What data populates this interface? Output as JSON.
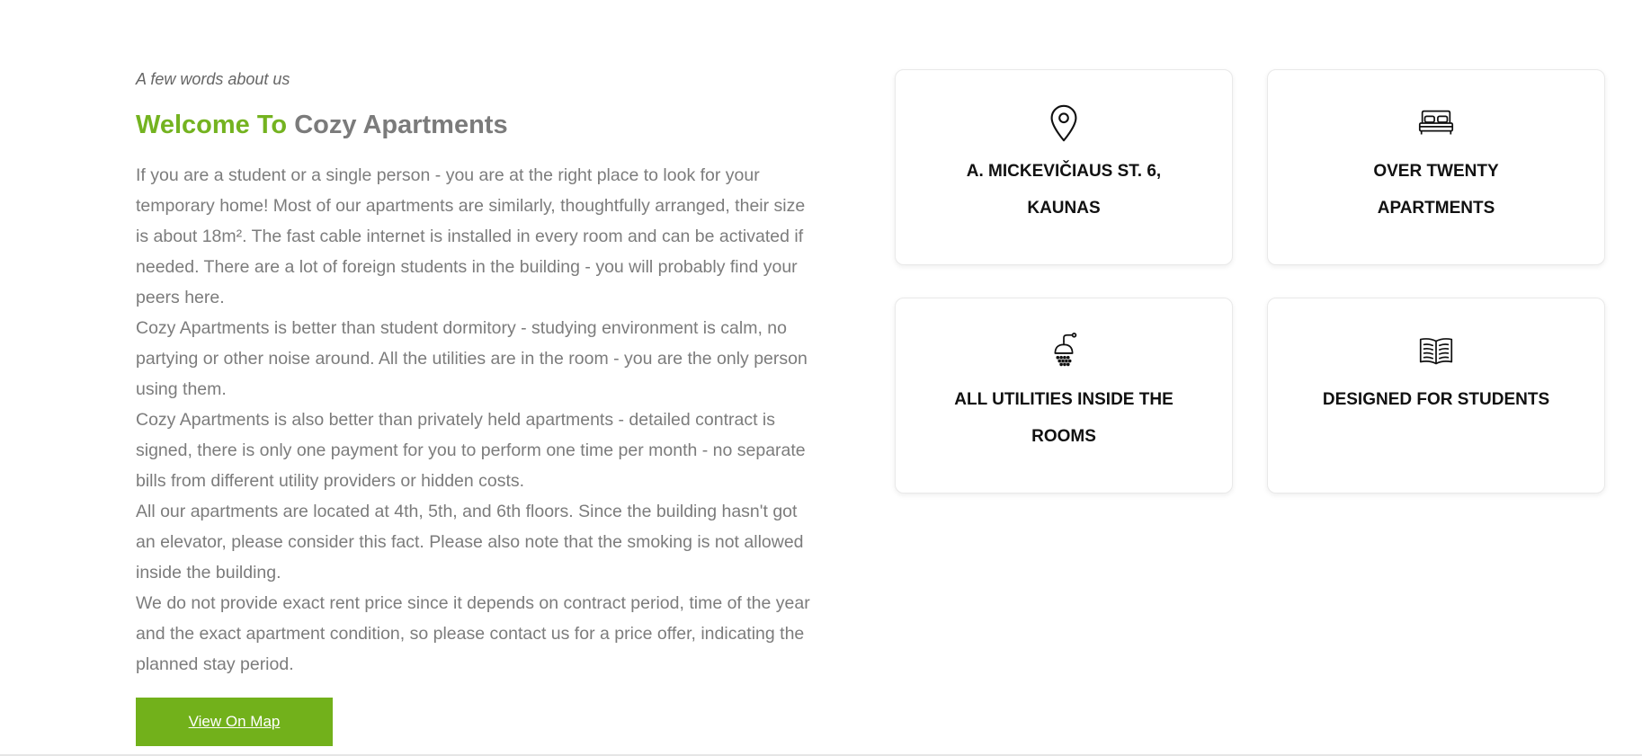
{
  "about": {
    "kicker": "A few words about us",
    "heading_highlight": "Welcome To",
    "heading_rest": "Cozy Apartments",
    "paragraphs": [
      "If you are a student or a single person - you are at the right place to look for your temporary home! Most of our apartments are similarly, thoughtfully arranged, their size is about 18m². The fast cable internet is installed in every room and can be activated if needed. There are a lot of foreign students in the building - you will probably find your peers here.",
      "Cozy Apartments is better than student dormitory - studying environment is calm, no partying or other noise around. All the utilities are in the room - you are the only person using them.",
      "Cozy Apartments is also better than privately held apartments - detailed contract is signed, there is only one payment for you to perform one time per month - no separate bills from different utility providers or hidden costs.",
      "All our apartments are located at 4th, 5th, and 6th floors. Since the building hasn't got an elevator, please consider this fact. Please also note that the smoking is not allowed inside the building.",
      "We do not provide exact rent price since it depends on contract period, time of the year and the exact apartment condition, so please contact us for a price offer, indicating the planned stay period."
    ],
    "button_label": "View On Map"
  },
  "features": [
    {
      "icon": "map-pin-icon",
      "label": "A. Mickevičiaus st. 6, Kaunas"
    },
    {
      "icon": "bed-icon",
      "label": "Over twenty apartments"
    },
    {
      "icon": "shower-icon",
      "label": "All utilities inside the rooms"
    },
    {
      "icon": "open-book-icon",
      "label": "Designed for students"
    }
  ],
  "colors": {
    "accent": "#74b320",
    "button": "#72b11b",
    "body_text": "#7c7c7c",
    "heading_grey": "#7b7b7b"
  }
}
